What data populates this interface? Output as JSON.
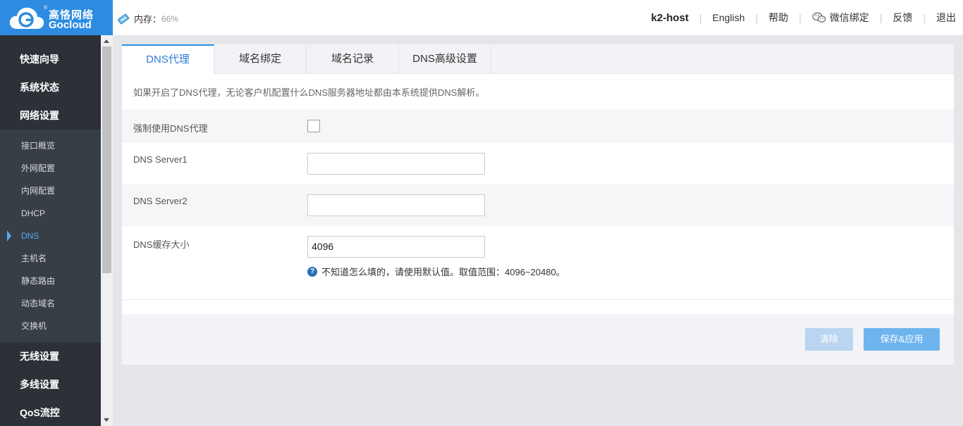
{
  "brand": {
    "name_cn": "高恪网络",
    "name_en": "Gocloud",
    "reg": "®"
  },
  "memory": {
    "label": "内存：",
    "value": "66%"
  },
  "topnav": {
    "host": "k2-host",
    "language": "English",
    "help": "帮助",
    "wechat": "微信绑定",
    "feedback": "反馈",
    "logout": "退出"
  },
  "sidebar": {
    "main_top": [
      {
        "label": "快速向导"
      },
      {
        "label": "系统状态"
      },
      {
        "label": "网络设置"
      }
    ],
    "sub": [
      {
        "label": "接口概览"
      },
      {
        "label": "外网配置"
      },
      {
        "label": "内网配置"
      },
      {
        "label": "DHCP"
      },
      {
        "label": "DNS",
        "active": true
      },
      {
        "label": "主机名"
      },
      {
        "label": "静态路由"
      },
      {
        "label": "动态域名"
      },
      {
        "label": "交换机"
      }
    ],
    "main_bottom": [
      {
        "label": "无线设置"
      },
      {
        "label": "多线设置"
      },
      {
        "label": "QoS流控"
      }
    ]
  },
  "tabs": [
    {
      "label": "DNS代理",
      "active": true
    },
    {
      "label": "域名绑定"
    },
    {
      "label": "域名记录"
    },
    {
      "label": "DNS高级设置"
    }
  ],
  "notice": "如果开启了DNS代理，无论客户机配置什么DNS服务器地址都由本系统提供DNS解析。",
  "form": {
    "force_label": "强制使用DNS代理",
    "force_checked": false,
    "server1_label": "DNS Server1",
    "server1_value": "",
    "server2_label": "DNS Server2",
    "server2_value": "",
    "cache_label": "DNS缓存大小",
    "cache_value": "4096",
    "hint": "不知道怎么填的，请使用默认值。取值范围：4096~20480。"
  },
  "buttons": {
    "clear": "清除",
    "save": "保存&应用"
  },
  "colors": {
    "brand": "#2e8ce0",
    "sidebar": "#2c3138",
    "active_link": "#5aa6f0"
  }
}
